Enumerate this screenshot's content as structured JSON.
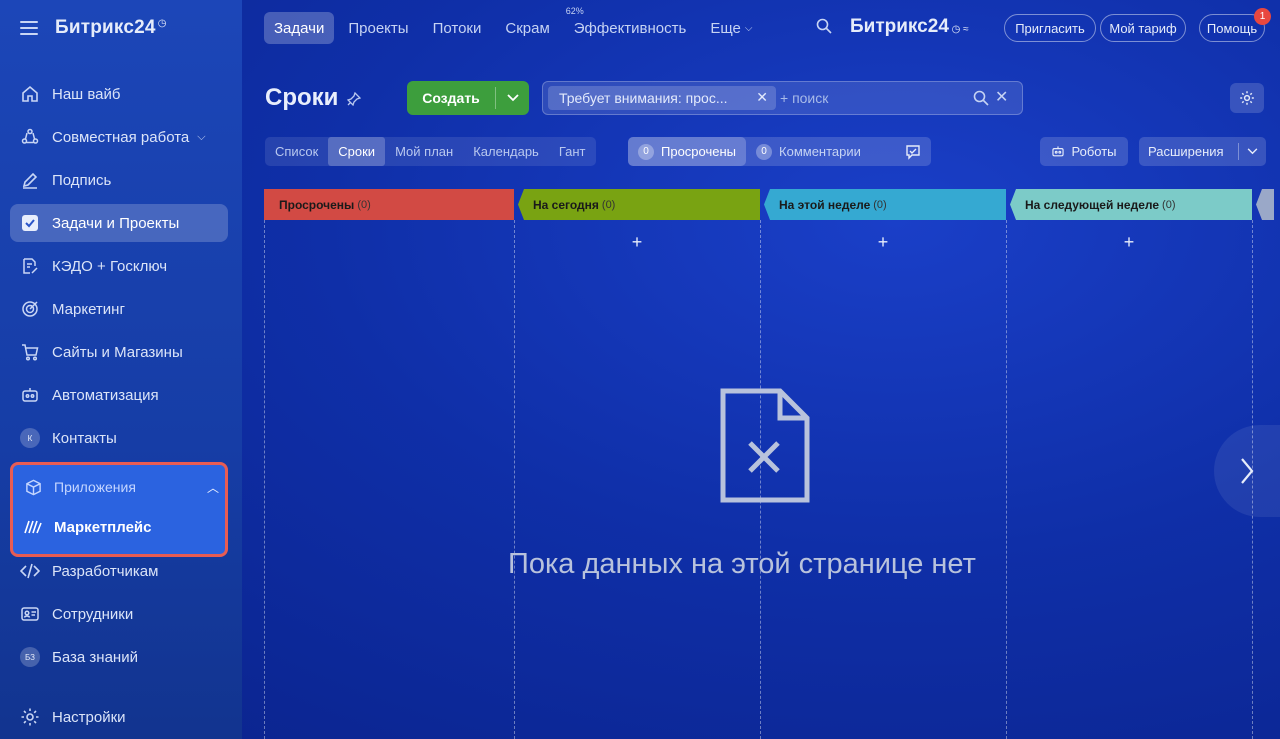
{
  "sidebar": {
    "brand": "Битрикс24",
    "items": [
      {
        "label": "Наш вайб",
        "icon": "home-icon"
      },
      {
        "label": "Совместная работа",
        "icon": "collaboration-icon"
      },
      {
        "label": "Подпись",
        "icon": "signature-icon"
      },
      {
        "label": "Задачи и Проекты",
        "icon": "tasks-icon"
      },
      {
        "label": "КЭДО + Госключ",
        "icon": "document-edit-icon"
      },
      {
        "label": "Маркетинг",
        "icon": "target-icon"
      },
      {
        "label": "Сайты и Магазины",
        "icon": "cart-icon"
      },
      {
        "label": "Автоматизация",
        "icon": "robot-icon"
      },
      {
        "label": "Контакты",
        "icon_letter": "К"
      }
    ],
    "apps_label": "Приложения",
    "marketplace_label": "Маркетплейс",
    "items2": [
      {
        "label": "Разработчикам",
        "icon": "code-icon"
      },
      {
        "label": "Сотрудники",
        "icon": "id-card-icon"
      },
      {
        "label": "База знаний",
        "icon_letter": "БЗ"
      }
    ],
    "settings_label": "Настройки"
  },
  "topbar": {
    "tabs": [
      "Задачи",
      "Проекты",
      "Потоки",
      "Скрам",
      "Эффективность",
      "Еще"
    ],
    "efficiency_badge": "62%",
    "brand": "Битрикс24",
    "invite_label": "Пригласить",
    "tariff_label": "Мой тариф",
    "help_label": "Помощь",
    "notifications_count": "1"
  },
  "toolbar": {
    "page_title": "Сроки",
    "create_label": "Создать",
    "filter_chip": "Требует внимания: прос...",
    "search_placeholder": "+ поиск"
  },
  "views": [
    "Список",
    "Сроки",
    "Мой план",
    "Календарь",
    "Гант"
  ],
  "counters": [
    {
      "count": "0",
      "label": "Просрочены"
    },
    {
      "count": "0",
      "label": "Комментарии"
    }
  ],
  "robots_label": "Роботы",
  "extensions_label": "Расширения",
  "columns": [
    {
      "title": "Просрочены",
      "count": "(0)",
      "color": "#d9534f"
    },
    {
      "title": "На сегодня",
      "count": "(0)",
      "color": "#8cbf1f"
    },
    {
      "title": "На этой неделе",
      "count": "(0)",
      "color": "#3fb8e0"
    },
    {
      "title": "На следующей неделе",
      "count": "(0)",
      "color": "#8ed8d4"
    }
  ],
  "empty_message": "Пока данных на этой странице нет"
}
